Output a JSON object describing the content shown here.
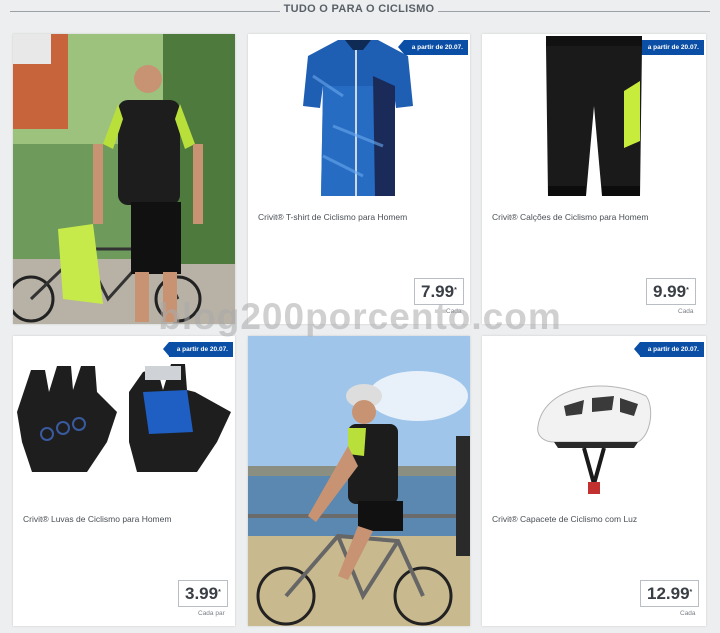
{
  "header": {
    "title": "TUDO O PARA O CICLISMO"
  },
  "products": [
    {
      "name": "Crivit® T-shirt de Ciclismo para Homem",
      "badge": "a partir de 20.07.",
      "price": "7.99",
      "asterisk": "*",
      "unit": "Cada"
    },
    {
      "name": "Crivit® Calções de Ciclismo para Homem",
      "badge": "a partir de 20.07.",
      "price": "9.99",
      "asterisk": "*",
      "unit": "Cada"
    },
    {
      "name": "Crivit® Luvas de Ciclismo para Homem",
      "badge": "a partir de 20.07.",
      "price": "3.99",
      "asterisk": "*",
      "unit": "Cada par"
    },
    {
      "name": "Crivit® Capacete de Ciclismo com Luz",
      "badge": "a partir de 20.07.",
      "price": "12.99",
      "asterisk": "*",
      "unit": "Cada"
    }
  ],
  "watermark": "blog200porcento.com",
  "colors": {
    "badge": "#0a4ea5",
    "jersey": "#1f5fb3",
    "accent_green": "#b9e03a",
    "background": "#eceeef"
  },
  "icons": [
    "cycling-jersey-image",
    "cycling-shorts-image",
    "cycling-gloves-image",
    "cycling-helmet-image",
    "cyclist-lifestyle-photo"
  ]
}
